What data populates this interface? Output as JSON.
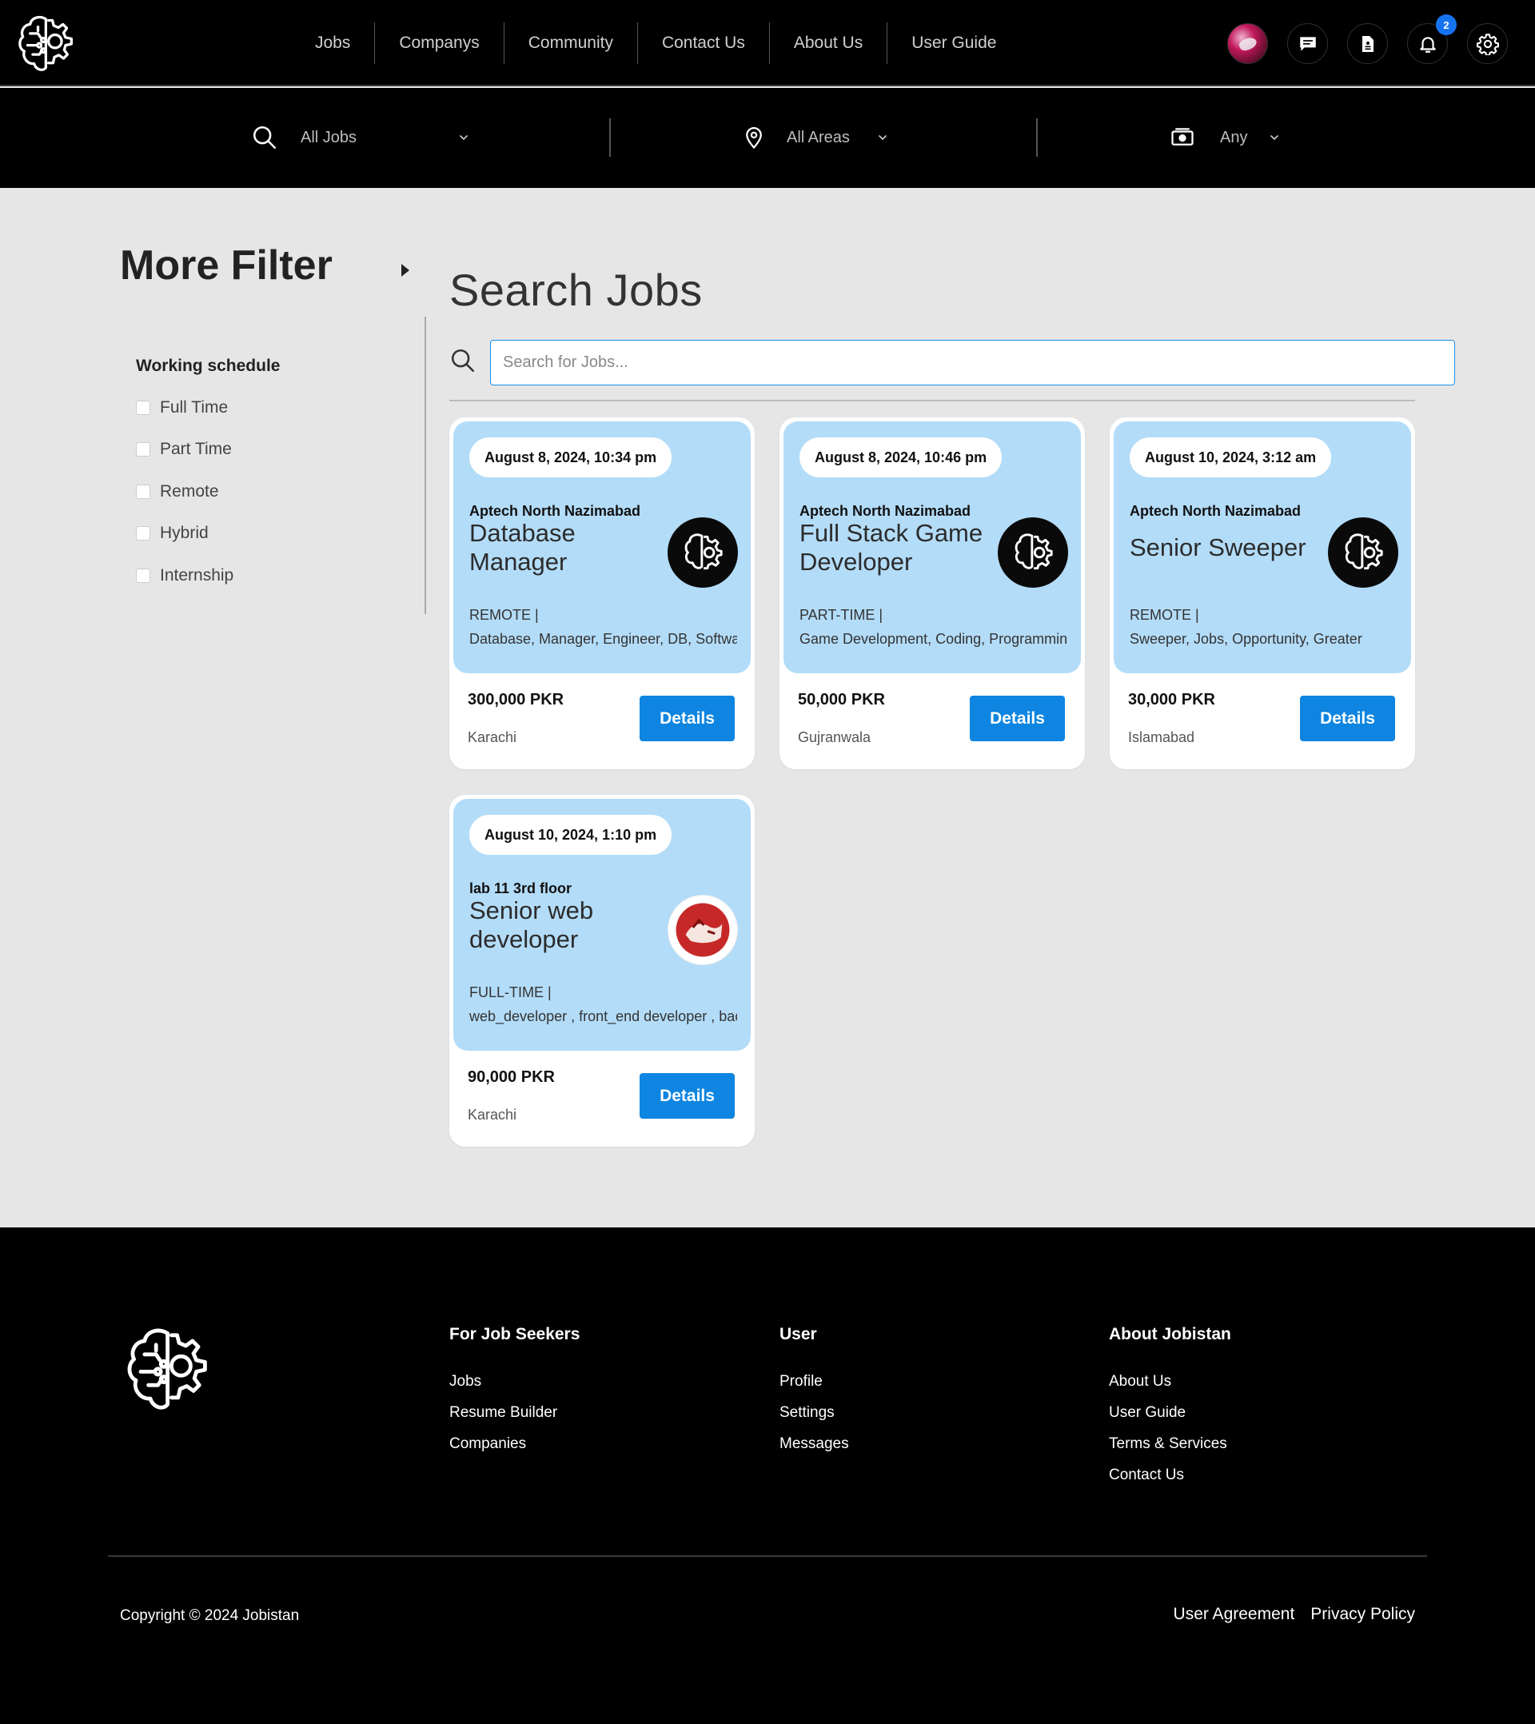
{
  "nav": {
    "links": [
      "Jobs",
      "Companys",
      "Community",
      "Contact Us",
      "About Us",
      "User Guide"
    ],
    "notification_count": "2",
    "icons": [
      "avatar",
      "chat-icon",
      "document-icon",
      "bell-icon",
      "gear-icon"
    ]
  },
  "searchbar": {
    "job_type": "All Jobs",
    "area": "All Areas",
    "salary": "Any"
  },
  "filter": {
    "title": "More Filter",
    "section_title": "Working schedule",
    "options": [
      "Full Time",
      "Part Time",
      "Remote",
      "Hybrid",
      "Internship"
    ]
  },
  "main": {
    "title": "Search Jobs",
    "search_placeholder": "Search for Jobs..."
  },
  "jobs": [
    {
      "date": "August 8, 2024, 10:34 pm",
      "company": "Aptech North Nazimabad",
      "title": "Database Manager",
      "type": "REMOTE |",
      "tags": "Database, Manager, Engineer, DB, Software",
      "salary": "300,000 PKR",
      "city": "Karachi",
      "button": "Details"
    },
    {
      "date": "August 8, 2024, 10:46 pm",
      "company": "Aptech North Nazimabad",
      "title": "Full Stack Game Developer",
      "type": "PART-TIME |",
      "tags": "Game Development, Coding, Programming",
      "salary": "50,000 PKR",
      "city": "Gujranwala",
      "button": "Details"
    },
    {
      "date": "August 10, 2024, 3:12 am",
      "company": "Aptech North Nazimabad",
      "title": "Senior Sweeper",
      "type": "REMOTE |",
      "tags": "Sweeper, Jobs, Opportunity, Greater",
      "salary": "30,000 PKR",
      "city": "Islamabad",
      "button": "Details"
    },
    {
      "date": "August 10, 2024, 1:10 pm",
      "company": "lab 11 3rd floor",
      "title": "Senior web developer",
      "type": "FULL-TIME |",
      "tags": "web_developer , front_end developer , back_end developer",
      "salary": "90,000 PKR",
      "city": "Karachi",
      "button": "Details"
    }
  ],
  "footer": {
    "columns": [
      {
        "title": "For Job Seekers",
        "links": [
          "Jobs",
          "Resume Builder",
          "Companies"
        ]
      },
      {
        "title": "User",
        "links": [
          "Profile",
          "Settings",
          "Messages"
        ]
      },
      {
        "title": "About Jobistan",
        "links": [
          "About Us",
          "User Guide",
          "Terms & Services",
          "Contact Us"
        ]
      }
    ],
    "copyright": "Copyright © 2024 Jobistan",
    "bottom_links": [
      "User Agreement",
      "Privacy Policy"
    ]
  },
  "colors": {
    "accent": "#0e85e0",
    "card_top": "#b3dcf8",
    "badge": "#1673f0",
    "header_bg": "#000000",
    "page_bg": "#e6e6e6"
  }
}
